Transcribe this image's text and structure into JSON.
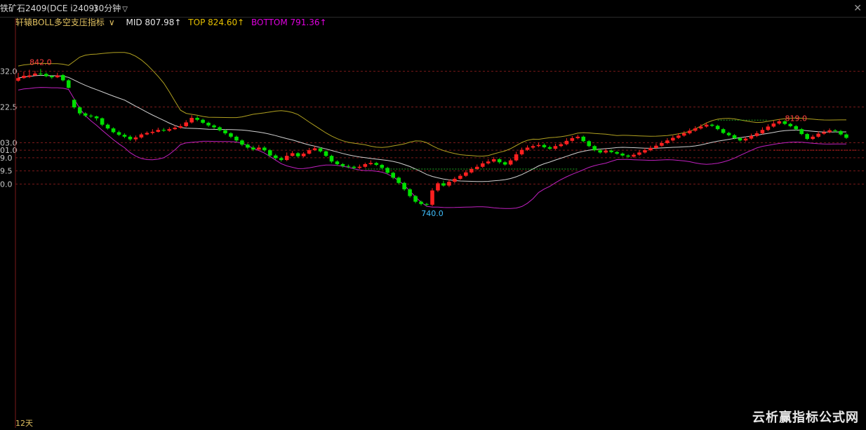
{
  "header": {
    "title": "铁矿石2409(DCE i2409)",
    "period": "30分钟",
    "close_glyph": "✕"
  },
  "legend": {
    "indicator": "轩辕BOLL多空支压指标",
    "mid": "MID 807.98↑",
    "top": "TOP 824.60↑",
    "bottom": "BOTTOM 791.36↑"
  },
  "footer": {
    "days": "12天"
  },
  "watermark": "云析赢指标公式网",
  "colors": {
    "up": "#ff2020",
    "down": "#00e000",
    "mid": "#d0d0d0",
    "top": "#b0a020",
    "bottom": "#c020c0",
    "grid": "#7a1a1a",
    "background": "#000000"
  },
  "chart_data": {
    "type": "candlestick",
    "y_tick_labels": [
      "32.0",
      "22.5",
      "03.0",
      "01.0",
      "9.0",
      "9.5",
      "0.0"
    ],
    "y_tick_values": [
      832.0,
      822.5,
      813.0,
      811.0,
      809.0,
      805.5,
      802.0
    ],
    "annotations": [
      {
        "text": "842.0",
        "color": "#ff4040",
        "bar": 4,
        "where": "above"
      },
      {
        "text": "819.0",
        "color": "#ff4040",
        "bar": 139,
        "where": "above"
      },
      {
        "text": "740.0",
        "color": "#40c0ff",
        "bar": 74,
        "where": "below"
      }
    ],
    "candles": [
      [
        829.5,
        830.2,
        831.6,
        829.2
      ],
      [
        830.2,
        830.8,
        831.9,
        830.0
      ],
      [
        830.5,
        830.9,
        832.4,
        830.2
      ],
      [
        830.9,
        831.4,
        832.1,
        830.7
      ],
      [
        831.4,
        831.3,
        832.6,
        830.9
      ],
      [
        831.3,
        830.7,
        831.7,
        830.4
      ],
      [
        830.7,
        830.4,
        831.0,
        830.0
      ],
      [
        830.4,
        830.9,
        831.6,
        830.2
      ],
      [
        831.0,
        829.6,
        831.3,
        829.3
      ],
      [
        829.6,
        827.6,
        829.9,
        827.4
      ],
      [
        824.4,
        822.4,
        824.7,
        822.0
      ],
      [
        822.4,
        820.8,
        822.7,
        820.3
      ],
      [
        820.8,
        820.2,
        821.1,
        819.8
      ],
      [
        820.2,
        820.0,
        820.6,
        819.6
      ],
      [
        820.0,
        819.5,
        820.2,
        818.9
      ],
      [
        819.5,
        817.8,
        819.7,
        817.4
      ],
      [
        817.8,
        816.8,
        818.1,
        816.5
      ],
      [
        816.8,
        815.8,
        817.1,
        815.5
      ],
      [
        815.8,
        815.1,
        816.2,
        814.8
      ],
      [
        815.1,
        814.6,
        815.5,
        814.2
      ],
      [
        814.6,
        813.9,
        815.0,
        813.5
      ],
      [
        813.9,
        814.4,
        814.9,
        813.3
      ],
      [
        814.4,
        815.2,
        815.6,
        814.1
      ],
      [
        815.2,
        815.6,
        816.0,
        815.0
      ],
      [
        815.6,
        815.9,
        816.6,
        815.2
      ],
      [
        815.9,
        816.4,
        817.0,
        815.7
      ],
      [
        816.4,
        816.2,
        816.9,
        815.9
      ],
      [
        816.2,
        816.6,
        817.1,
        815.9
      ],
      [
        816.6,
        817.0,
        817.6,
        816.4
      ],
      [
        817.0,
        817.4,
        818.0,
        816.7
      ],
      [
        817.4,
        818.4,
        819.0,
        817.1
      ],
      [
        818.4,
        819.6,
        820.3,
        818.1
      ],
      [
        819.6,
        819.1,
        820.1,
        818.7
      ],
      [
        819.1,
        818.3,
        819.4,
        818.0
      ],
      [
        818.3,
        817.6,
        818.6,
        817.2
      ],
      [
        817.6,
        817.1,
        817.9,
        816.7
      ],
      [
        817.1,
        816.3,
        817.4,
        816.0
      ],
      [
        816.3,
        815.5,
        816.6,
        815.1
      ],
      [
        815.5,
        814.6,
        815.8,
        814.2
      ],
      [
        814.6,
        813.6,
        814.9,
        813.2
      ],
      [
        813.6,
        812.5,
        813.9,
        812.1
      ],
      [
        812.5,
        811.7,
        812.8,
        811.3
      ],
      [
        811.7,
        811.2,
        812.2,
        810.8
      ],
      [
        811.2,
        811.7,
        812.4,
        810.9
      ],
      [
        811.7,
        811.0,
        812.1,
        810.6
      ],
      [
        811.0,
        809.6,
        811.3,
        809.2
      ],
      [
        809.6,
        808.9,
        810.0,
        808.5
      ],
      [
        808.9,
        808.4,
        809.3,
        808.0
      ],
      [
        808.4,
        809.5,
        810.4,
        808.1
      ],
      [
        809.5,
        810.2,
        810.8,
        809.3
      ],
      [
        810.2,
        809.4,
        810.5,
        809.0
      ],
      [
        809.4,
        810.1,
        810.5,
        809.1
      ],
      [
        810.1,
        811.0,
        811.6,
        809.9
      ],
      [
        811.0,
        811.5,
        812.1,
        810.8
      ],
      [
        811.5,
        810.7,
        811.8,
        810.4
      ],
      [
        810.7,
        809.5,
        811.0,
        809.2
      ],
      [
        809.5,
        808.0,
        809.8,
        807.6
      ],
      [
        808.0,
        807.3,
        808.3,
        806.9
      ],
      [
        807.3,
        806.8,
        807.6,
        806.4
      ],
      [
        806.8,
        806.6,
        807.2,
        806.2
      ],
      [
        806.6,
        806.3,
        806.9,
        805.9
      ],
      [
        806.3,
        806.6,
        807.2,
        806.0
      ],
      [
        806.6,
        807.3,
        807.7,
        806.3
      ],
      [
        807.3,
        807.6,
        808.3,
        807.0
      ],
      [
        807.6,
        807.1,
        807.9,
        806.8
      ],
      [
        807.1,
        806.3,
        807.4,
        805.9
      ],
      [
        806.3,
        805.0,
        806.6,
        804.6
      ],
      [
        805.0,
        803.7,
        805.3,
        803.3
      ],
      [
        803.7,
        802.3,
        804.0,
        801.9
      ],
      [
        802.3,
        800.6,
        802.6,
        800.2
      ],
      [
        800.6,
        798.8,
        800.9,
        798.4
      ],
      [
        798.8,
        797.3,
        799.1,
        796.9
      ],
      [
        797.3,
        796.7,
        797.6,
        796.3
      ],
      [
        796.7,
        796.5,
        797.0,
        796.1
      ],
      [
        796.5,
        800.3,
        800.9,
        796.1
      ],
      [
        800.3,
        802.2,
        802.6,
        799.9
      ],
      [
        802.2,
        801.6,
        802.9,
        801.3
      ],
      [
        801.6,
        802.6,
        803.2,
        801.2
      ],
      [
        802.6,
        803.4,
        803.9,
        802.2
      ],
      [
        803.4,
        804.2,
        804.7,
        803.1
      ],
      [
        804.2,
        805.1,
        805.7,
        803.9
      ],
      [
        805.1,
        806.0,
        806.5,
        804.8
      ],
      [
        806.0,
        806.6,
        807.2,
        805.7
      ],
      [
        806.6,
        807.5,
        808.1,
        806.3
      ],
      [
        807.5,
        808.0,
        808.6,
        807.2
      ],
      [
        808.0,
        808.6,
        809.2,
        807.7
      ],
      [
        808.6,
        807.8,
        808.9,
        807.4
      ],
      [
        807.8,
        807.2,
        808.1,
        806.9
      ],
      [
        807.2,
        808.3,
        808.8,
        806.9
      ],
      [
        808.3,
        809.9,
        810.6,
        808.0
      ],
      [
        809.9,
        811.1,
        811.7,
        809.6
      ],
      [
        811.1,
        811.7,
        812.3,
        810.8
      ],
      [
        811.7,
        812.1,
        812.6,
        811.3
      ],
      [
        812.1,
        812.4,
        813.0,
        811.8
      ],
      [
        812.4,
        811.8,
        812.8,
        811.5
      ],
      [
        811.8,
        811.4,
        812.2,
        811.1
      ],
      [
        811.4,
        812.1,
        812.7,
        811.1
      ],
      [
        812.1,
        812.6,
        813.1,
        811.8
      ],
      [
        812.6,
        813.5,
        814.2,
        812.3
      ],
      [
        813.5,
        814.2,
        814.8,
        813.2
      ],
      [
        814.2,
        814.6,
        815.1,
        813.9
      ],
      [
        814.6,
        813.4,
        814.9,
        813.1
      ],
      [
        813.4,
        812.1,
        813.7,
        811.8
      ],
      [
        812.1,
        811.0,
        812.4,
        810.7
      ],
      [
        811.0,
        810.4,
        811.3,
        810.1
      ],
      [
        810.4,
        810.9,
        811.4,
        810.1
      ],
      [
        810.9,
        810.5,
        811.2,
        810.2
      ],
      [
        810.5,
        810.1,
        810.8,
        809.8
      ],
      [
        810.1,
        809.6,
        810.4,
        809.3
      ],
      [
        809.6,
        809.3,
        809.9,
        809.0
      ],
      [
        809.3,
        809.8,
        810.3,
        809.0
      ],
      [
        809.8,
        810.4,
        811.0,
        809.5
      ],
      [
        810.4,
        811.0,
        811.6,
        810.1
      ],
      [
        811.0,
        811.6,
        812.2,
        810.7
      ],
      [
        811.6,
        812.2,
        812.8,
        811.3
      ],
      [
        812.2,
        812.9,
        813.5,
        811.9
      ],
      [
        812.9,
        813.6,
        814.2,
        812.6
      ],
      [
        813.6,
        814.3,
        814.9,
        813.3
      ],
      [
        814.3,
        814.9,
        815.5,
        814.0
      ],
      [
        814.9,
        815.5,
        816.1,
        814.6
      ],
      [
        815.5,
        816.2,
        816.8,
        815.2
      ],
      [
        816.2,
        816.8,
        817.4,
        815.9
      ],
      [
        816.8,
        817.3,
        817.9,
        816.5
      ],
      [
        817.3,
        817.8,
        818.4,
        817.0
      ],
      [
        817.8,
        817.5,
        818.1,
        817.2
      ],
      [
        817.5,
        816.6,
        817.8,
        816.3
      ],
      [
        816.6,
        815.6,
        816.9,
        815.3
      ],
      [
        815.6,
        815.0,
        815.9,
        814.7
      ],
      [
        815.0,
        814.2,
        815.3,
        813.9
      ],
      [
        814.2,
        813.6,
        814.5,
        813.3
      ],
      [
        813.6,
        814.1,
        814.6,
        813.3
      ],
      [
        814.1,
        814.8,
        815.4,
        813.8
      ],
      [
        814.8,
        815.5,
        816.1,
        814.5
      ],
      [
        815.5,
        816.4,
        817.1,
        815.2
      ],
      [
        816.4,
        817.3,
        817.9,
        816.1
      ],
      [
        817.3,
        818.1,
        818.8,
        817.0
      ],
      [
        818.1,
        818.7,
        819.3,
        817.8
      ],
      [
        818.7,
        818.0,
        819.0,
        817.7
      ],
      [
        818.0,
        817.4,
        818.3,
        817.1
      ],
      [
        817.4,
        816.6,
        817.7,
        816.3
      ],
      [
        816.6,
        815.3,
        816.9,
        815.0
      ],
      [
        815.3,
        814.0,
        815.6,
        813.7
      ],
      [
        814.0,
        814.6,
        815.1,
        813.7
      ],
      [
        814.6,
        815.4,
        816.0,
        814.3
      ],
      [
        815.4,
        815.8,
        816.4,
        815.1
      ],
      [
        815.8,
        816.3,
        816.8,
        815.5
      ],
      [
        816.3,
        816.1,
        816.6,
        815.8
      ],
      [
        816.1,
        815.2,
        816.4,
        814.9
      ],
      [
        815.2,
        814.3,
        815.5,
        814.0
      ]
    ],
    "y_range": [
      739.0,
      843.5
    ],
    "levels": [
      {
        "value": 806.0,
        "from_bar": 62,
        "to_bar": 100,
        "color": "#22aa22",
        "style": "dashed"
      },
      {
        "value": 819.0,
        "from_bar": 125,
        "to_bar": 134,
        "color": "#22aa22",
        "style": "dashed"
      },
      {
        "value": 811.0,
        "from_bar": 135,
        "to_bar": 150,
        "color": "#cc2222",
        "style": "dashed"
      }
    ]
  }
}
